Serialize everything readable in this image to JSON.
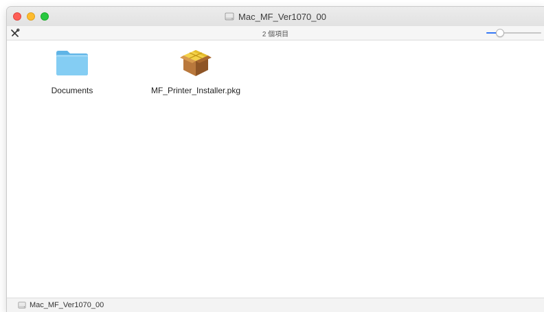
{
  "window": {
    "title": "Mac_MF_Ver1070_00",
    "title_icon": "disk-image-icon"
  },
  "toolbar": {
    "tools_icon": "tools-icon",
    "item_count": "2 個項目",
    "zoom_level": 0.2
  },
  "items": [
    {
      "name": "Documents",
      "icon": "folder-icon"
    },
    {
      "name": "MF_Printer_Installer.pkg",
      "icon": "package-icon"
    }
  ],
  "statusbar": {
    "path_label": "Mac_MF_Ver1070_00",
    "path_icon": "disk-image-icon"
  },
  "colors": {
    "close": "#fe5f57",
    "minimize": "#febc2e",
    "maximize": "#28c840",
    "folder": "#72c3f0",
    "accent": "#3478f6"
  }
}
